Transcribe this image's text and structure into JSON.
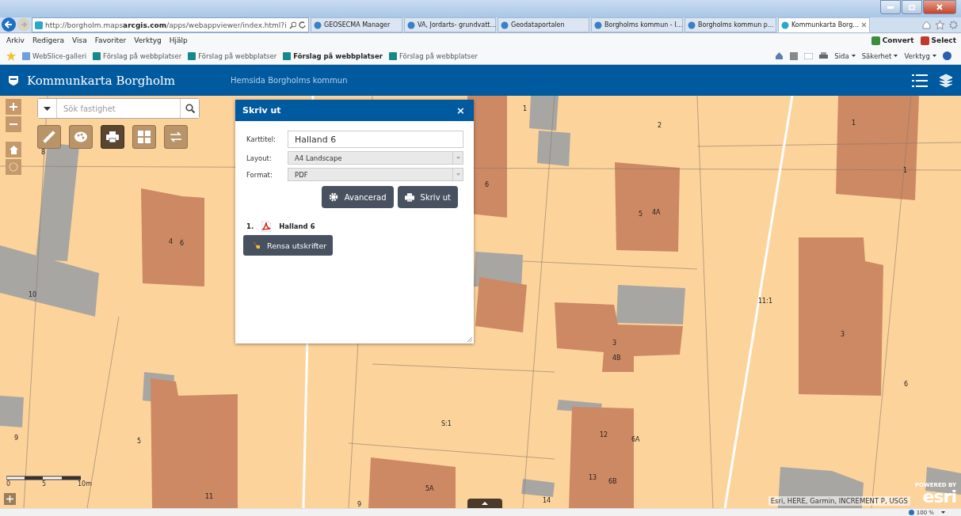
{
  "browser": {
    "address": "http://borgholm.maps**arcgis.com**/apps/webappviewer/index.html?i",
    "tabs": [
      {
        "label": "GEOSECMA Manager",
        "selected": false
      },
      {
        "label": "VA, Jordarts- grundvatt...",
        "selected": false
      },
      {
        "label": "Geodataportalen",
        "selected": false
      },
      {
        "label": "Borgholms kommun - I...",
        "selected": false
      },
      {
        "label": "Borgholms kommun p...",
        "selected": false
      },
      {
        "label": "Kommunkarta Borg...",
        "selected": true
      }
    ],
    "menu": [
      "Arkiv",
      "Redigera",
      "Visa",
      "Favoriter",
      "Verktyg",
      "Hjälp"
    ],
    "favorites": [
      {
        "label": "WebSlice-galleri",
        "bold": false
      },
      {
        "label": "Förslag på webbplatser",
        "bold": false
      },
      {
        "label": "Förslag på webbplatser",
        "bold": false
      },
      {
        "label": "Förslag på webbplatser",
        "bold": true
      },
      {
        "label": "Förslag på webbplatser",
        "bold": false
      }
    ],
    "addons": [
      "Convert",
      "Select"
    ],
    "command_bar": [
      "Sida",
      "Säkerhet",
      "Verktyg"
    ]
  },
  "app": {
    "title": "Kommunkarta Borgholm",
    "link": "Hemsida Borgholms kommun"
  },
  "search": {
    "placeholder": "Sök fastighet"
  },
  "tools": [
    {
      "kind": "ruler",
      "selected": false
    },
    {
      "kind": "palette",
      "selected": false
    },
    {
      "kind": "printer",
      "selected": true
    },
    {
      "kind": "grid",
      "selected": false
    },
    {
      "kind": "swap",
      "selected": false
    }
  ],
  "print_dialog": {
    "title": "Skriv ut",
    "close": "×",
    "fields": [
      {
        "label": "Karttitel:",
        "kind": "text",
        "value": "Halland 6"
      },
      {
        "label": "Layout:",
        "kind": "select",
        "value": "A4 Landscape"
      },
      {
        "label": "Format:",
        "kind": "select",
        "value": "PDF"
      }
    ],
    "buttons": [
      {
        "kind": "gear",
        "label": "Avancerad"
      },
      {
        "kind": "printer",
        "label": "Skriv ut"
      }
    ],
    "results": [
      {
        "number": "1.",
        "name": "Halland 6"
      }
    ],
    "clear_button": "Rensa utskrifter"
  },
  "map": {
    "labels": [
      "1",
      "2",
      "1",
      "8",
      "1",
      "6",
      "5",
      "4A",
      "4",
      "6",
      "10",
      "11:1",
      "3",
      "4B",
      "3",
      "6",
      "S:1",
      "9",
      "5",
      "12",
      "6A",
      "13",
      "6B",
      "5A",
      "11",
      "9",
      "14"
    ],
    "scale_labels": [
      "0",
      "5",
      "10m"
    ],
    "attribution": "Esri, HERE, Garmin, INCREMENT P, USGS",
    "logo": {
      "tagline": "POWERED BY",
      "name": "esri"
    }
  },
  "status_bar": {
    "zoom": "100 %"
  }
}
